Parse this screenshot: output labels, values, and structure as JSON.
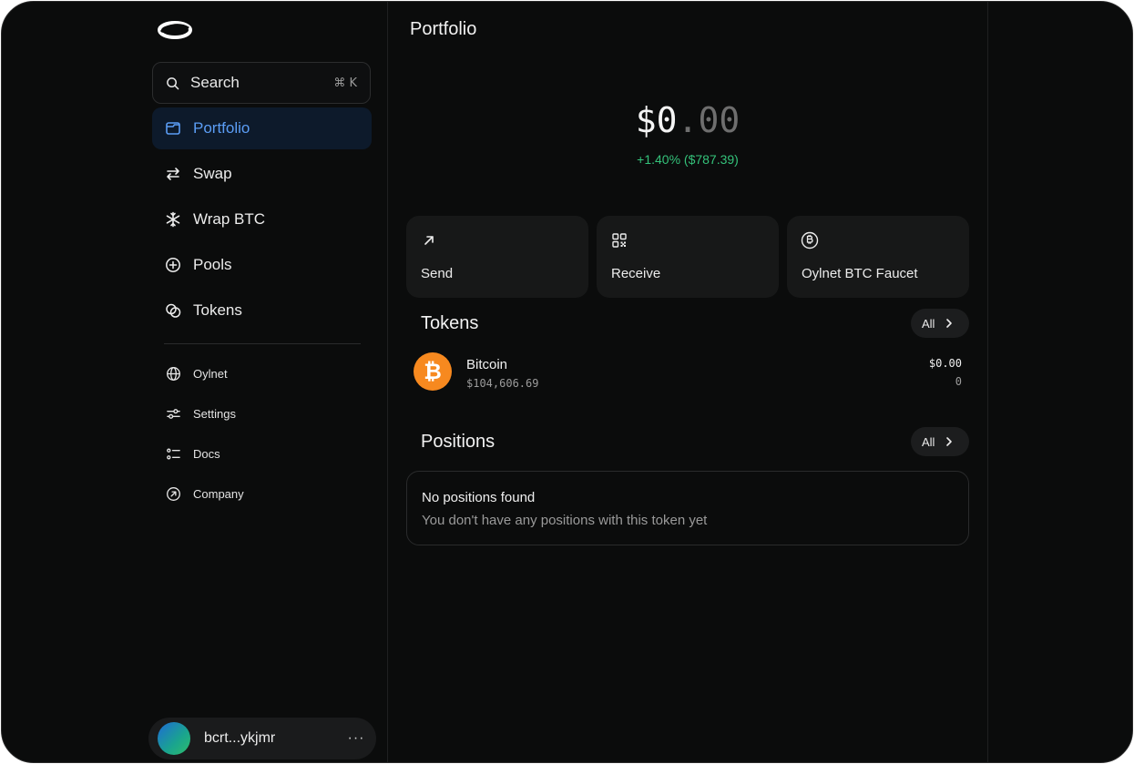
{
  "sidebar": {
    "search": {
      "label": "Search",
      "shortcut": "⌘ K"
    },
    "nav": [
      {
        "label": "Portfolio",
        "icon": "portfolio-icon",
        "active": true
      },
      {
        "label": "Swap",
        "icon": "swap-icon"
      },
      {
        "label": "Wrap BTC",
        "icon": "snowflake-icon"
      },
      {
        "label": "Pools",
        "icon": "plus-circle-icon"
      },
      {
        "label": "Tokens",
        "icon": "tokens-icon"
      }
    ],
    "secondary": [
      {
        "label": "Oylnet",
        "icon": "globe-icon"
      },
      {
        "label": "Settings",
        "icon": "sliders-icon"
      },
      {
        "label": "Docs",
        "icon": "list-icon"
      },
      {
        "label": "Company",
        "icon": "arrow-circle-icon"
      }
    ],
    "account": {
      "address": "bcrt...ykjmr",
      "more": "···"
    }
  },
  "main": {
    "title": "Portfolio",
    "balance": {
      "whole": "$0",
      "decimal": ".00"
    },
    "change": "+1.40% ($787.39)",
    "actions": [
      {
        "label": "Send",
        "icon": "arrow-up-right-icon"
      },
      {
        "label": "Receive",
        "icon": "qr-code-icon"
      },
      {
        "label": "Oylnet BTC Faucet",
        "icon": "bitcoin-circle-icon"
      }
    ],
    "tokens": {
      "title": "Tokens",
      "all_label": "All",
      "items": [
        {
          "name": "Bitcoin",
          "price": "$104,606.69",
          "value": "$0.00",
          "amount": "0"
        }
      ]
    },
    "positions": {
      "title": "Positions",
      "all_label": "All",
      "empty_title": "No positions found",
      "empty_subtitle": "You don't have any positions with this token yet"
    }
  },
  "colors": {
    "background": "#0b0c0c",
    "accent": "#5b9df5",
    "positive": "#34c27a",
    "bitcoin": "#f7891f"
  }
}
